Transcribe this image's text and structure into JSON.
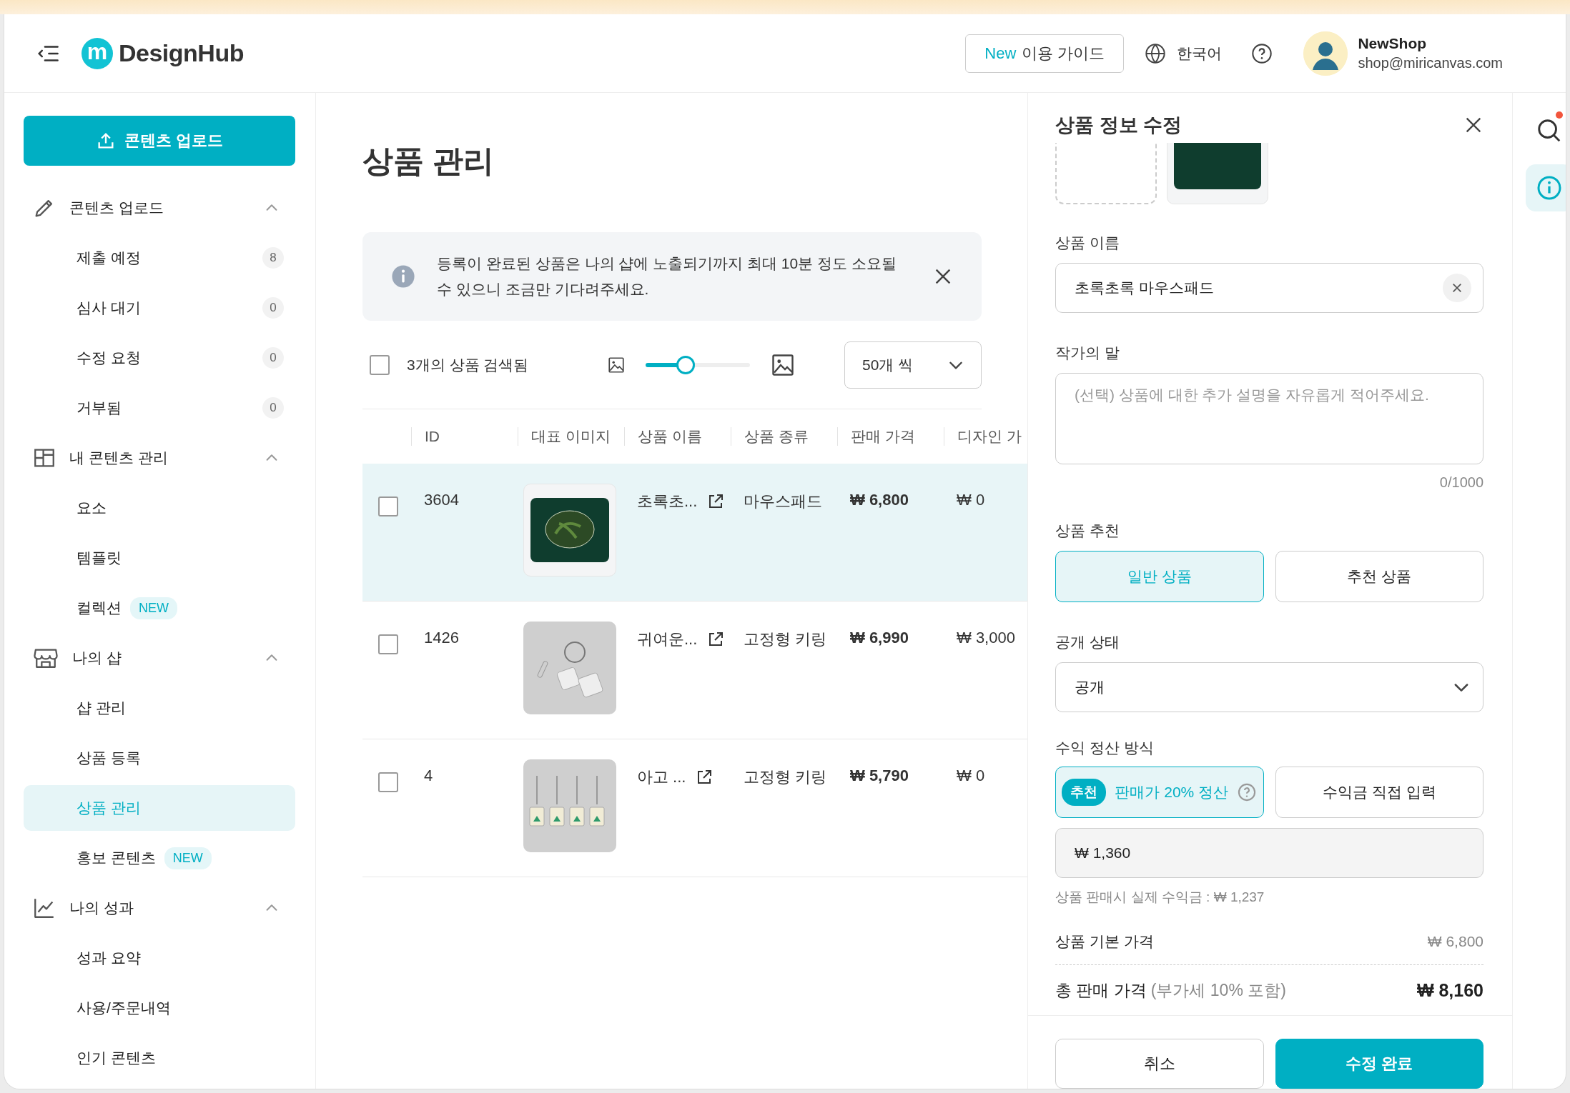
{
  "header": {
    "logo_mark": "m",
    "logo_text": "DesignHub",
    "guide_button": {
      "badge": "New",
      "label": "이용 가이드"
    },
    "language": "한국어",
    "user": {
      "name": "NewShop",
      "email": "shop@miricanvas.com"
    }
  },
  "sidebar": {
    "upload_button": "콘텐츠 업로드",
    "sections": [
      {
        "kind": "pencil",
        "title": "콘텐츠 업로드",
        "expanded": true,
        "items": [
          {
            "label": "제출 예정",
            "count": "8",
            "selected": false
          },
          {
            "label": "심사 대기",
            "count": "0",
            "selected": false
          },
          {
            "label": "수정 요청",
            "count": "0",
            "selected": false
          },
          {
            "label": "거부됨",
            "count": "0",
            "selected": false
          }
        ]
      },
      {
        "kind": "layout",
        "title": "내 콘텐츠 관리",
        "expanded": true,
        "items": [
          {
            "label": "요소",
            "selected": false
          },
          {
            "label": "템플릿",
            "selected": false
          },
          {
            "label": "컬렉션",
            "badge": "NEW",
            "selected": false
          }
        ]
      },
      {
        "kind": "shop",
        "title": "나의 샵",
        "expanded": true,
        "items": [
          {
            "label": "샵 관리",
            "selected": false
          },
          {
            "label": "상품 등록",
            "selected": false
          },
          {
            "label": "상품 관리",
            "selected": true
          },
          {
            "label": "홍보 콘텐츠",
            "badge": "NEW",
            "selected": false
          }
        ]
      },
      {
        "kind": "chart",
        "title": "나의 성과",
        "expanded": true,
        "items": [
          {
            "label": "성과 요약",
            "selected": false
          },
          {
            "label": "사용/주문내역",
            "selected": false
          },
          {
            "label": "인기 콘텐츠",
            "selected": false
          }
        ]
      }
    ]
  },
  "main": {
    "title": "상품 관리",
    "notice": "등록이 완료된 상품은 나의 샵에 노출되기까지 최대 10분 정도 소요될 수 있으니 조금만 기다려주세요.",
    "toolbar": {
      "select_all_checked": false,
      "result_text": "3개의 상품 검색됨",
      "thumbnail_size": {
        "level": 0.36
      },
      "page_size": "50개 씩"
    },
    "table": {
      "columns": [
        "ID",
        "대표 이미지",
        "상품 이름",
        "상품 종류",
        "판매 가격",
        "디자인 가"
      ],
      "rows": [
        {
          "selected": true,
          "checked": false,
          "id": "3604",
          "kind": "mousepad",
          "name": "초록초...",
          "type": "마우스패드",
          "price": "₩ 6,800",
          "design_price": "₩ 0"
        },
        {
          "selected": false,
          "checked": false,
          "id": "1426",
          "kind": "keyring",
          "name": "귀여운...",
          "type": "고정형 키링",
          "price": "₩ 6,990",
          "design_price": "₩ 3,000"
        },
        {
          "selected": false,
          "checked": false,
          "id": "4",
          "kind": "keyring-set",
          "name": "아고 ...",
          "type": "고정형 키링",
          "price": "₩ 5,790",
          "design_price": "₩ 0"
        }
      ]
    }
  },
  "edit_panel": {
    "title": "상품 정보 수정",
    "product_name": {
      "label": "상품 이름",
      "value": "초록초록 마우스패드"
    },
    "artist_note": {
      "label": "작가의 말",
      "placeholder": "(선택) 상품에 대한 추가 설명을 자유롭게 적어주세요.",
      "counter": "0/1000"
    },
    "recommendation": {
      "label": "상품 추천",
      "options": [
        {
          "label": "일반 상품",
          "selected": true
        },
        {
          "label": "추천 상품",
          "selected": false
        }
      ]
    },
    "visibility": {
      "label": "공개 상태",
      "value": "공개"
    },
    "settlement": {
      "label": "수익 정산 방식",
      "options": [
        {
          "badge": "추천",
          "label": "판매가 20% 정산",
          "help": true,
          "selected": true
        },
        {
          "label": "수익금 직접 입력",
          "help": false,
          "selected": false
        }
      ],
      "amount": "₩ 1,360",
      "actual_profit": "상품 판매시 실제 수익금 : ₩ 1,237"
    },
    "base_price": {
      "label": "상품 기본 가격",
      "value": "₩ 6,800"
    },
    "total_price": {
      "label": "총 판매 가격",
      "note": "(부가세 10% 포함)",
      "value": "₩ 8,160"
    },
    "buttons": {
      "cancel": "취소",
      "submit": "수정 완료"
    }
  },
  "right_rail": [
    {
      "kind": "search",
      "notification": true,
      "selected": false
    },
    {
      "kind": "info",
      "notification": false,
      "selected": true
    }
  ]
}
